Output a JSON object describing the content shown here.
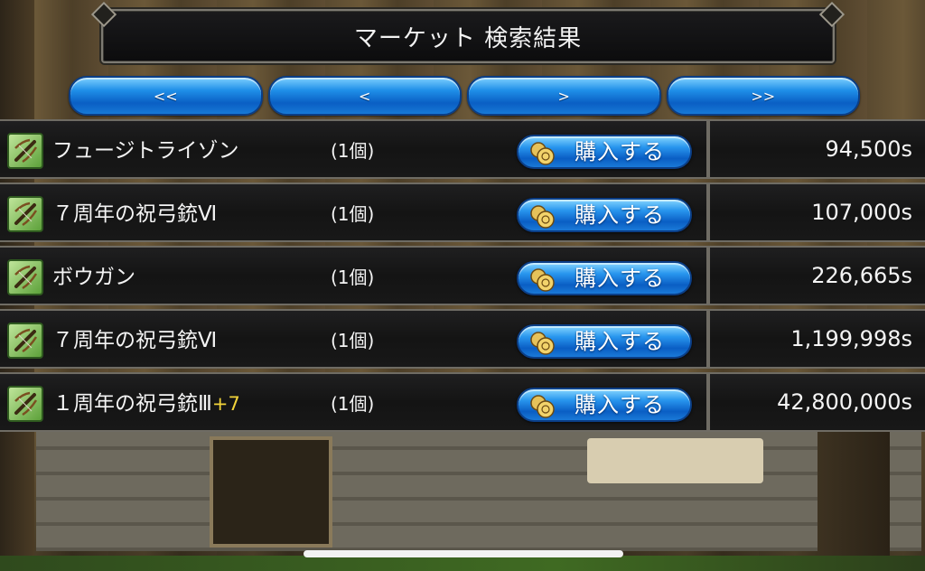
{
  "header": {
    "title": "マーケット 検索結果"
  },
  "pager": {
    "first": "<<",
    "prev": "<",
    "next": ">",
    "last": ">>"
  },
  "listings": [
    {
      "name": "フュージトライゾン",
      "plus": "",
      "quantity": "(1個)",
      "buy_label": "購入する",
      "price": "94,500s"
    },
    {
      "name": "７周年の祝弓銃Ⅵ",
      "plus": "",
      "quantity": "(1個)",
      "buy_label": "購入する",
      "price": "107,000s"
    },
    {
      "name": "ボウガン",
      "plus": "",
      "quantity": "(1個)",
      "buy_label": "購入する",
      "price": "226,665s"
    },
    {
      "name": "７周年の祝弓銃Ⅵ",
      "plus": "",
      "quantity": "(1個)",
      "buy_label": "購入する",
      "price": "1,199,998s"
    },
    {
      "name": "１周年の祝弓銃Ⅲ",
      "plus": "+7",
      "quantity": "(1個)",
      "buy_label": "購入する",
      "price": "42,800,000s"
    }
  ],
  "icons": {
    "item": "crossbow-icon",
    "buy": "coin-icon"
  },
  "colors": {
    "accent_blue": "#1f8fe8",
    "enhance_yellow": "#f2d43a",
    "item_icon_green": "#5da13a"
  }
}
